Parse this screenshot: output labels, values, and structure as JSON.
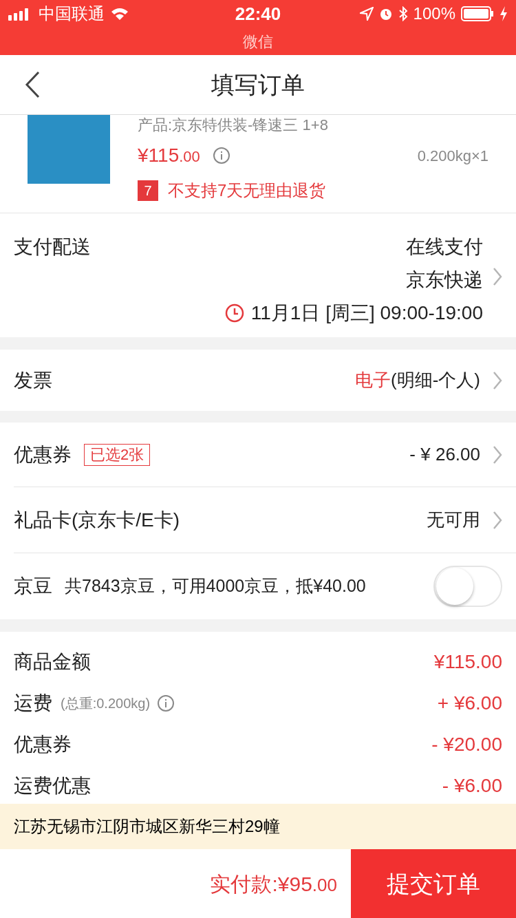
{
  "status_bar": {
    "carrier": "中国联通",
    "time": "22:40",
    "battery": "100%",
    "app_hint": "微信"
  },
  "nav": {
    "title": "填写订单"
  },
  "product": {
    "spec": "产品:京东特供装-锋速三 1+8",
    "price_main": "¥115",
    "price_cents": ".00",
    "weight": "0.200kg×1",
    "badge": "7",
    "return_note": "不支持7天无理由退货"
  },
  "delivery": {
    "label": "支付配送",
    "payment": "在线支付",
    "shipping": "京东快递",
    "time": "11月1日 [周三] 09:00-19:00"
  },
  "invoice": {
    "label": "发票",
    "type": "电子",
    "detail": "(明细-个人)"
  },
  "coupon": {
    "label": "优惠券",
    "tag": "已选2张",
    "value": "- ¥ 26.00"
  },
  "gift_card": {
    "label": "礼品卡(京东卡/E卡)",
    "value": "无可用"
  },
  "beans": {
    "label": "京豆",
    "detail": "共7843京豆，可用4000京豆，抵¥40.00",
    "on": false
  },
  "summary": [
    {
      "label": "商品金额",
      "value": "¥115.00"
    },
    {
      "label": "运费",
      "note": "(总重:0.200kg)",
      "value": "+ ¥6.00",
      "info": true
    },
    {
      "label": "优惠券",
      "value": "- ¥20.00"
    },
    {
      "label": "运费优惠",
      "value": "- ¥6.00"
    }
  ],
  "address": "江苏无锡市江阴市城区新华三村29幢",
  "footer": {
    "total_label": "实付款:",
    "total_main": "¥95",
    "total_cents": ".00",
    "submit": "提交订单"
  }
}
